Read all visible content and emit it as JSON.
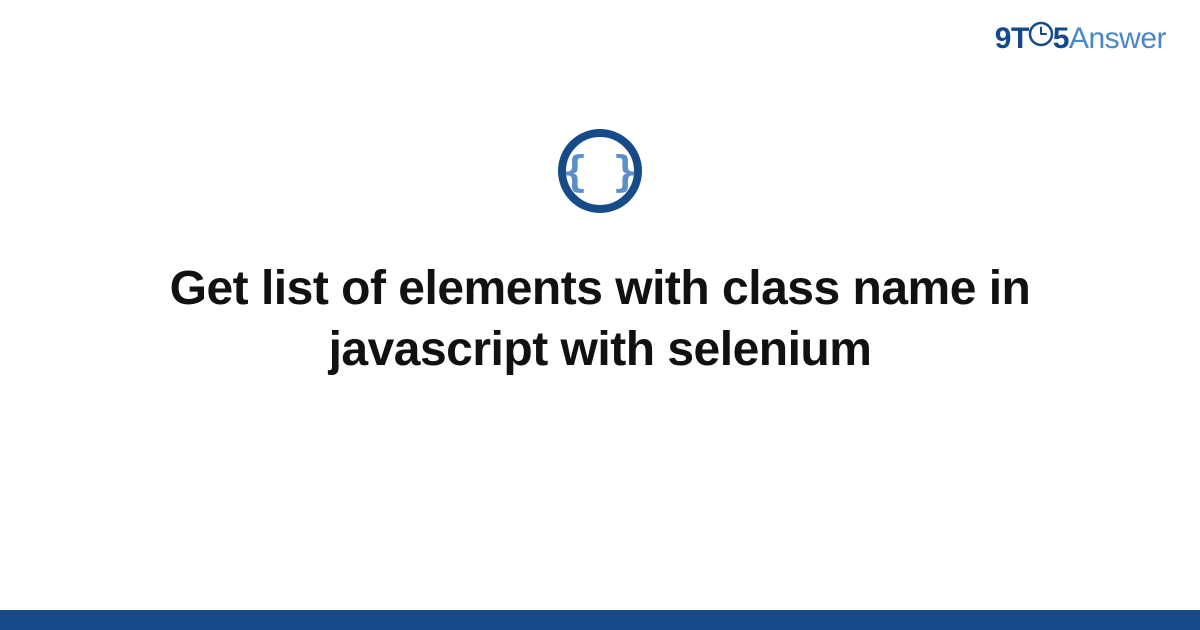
{
  "brand": {
    "nine": "9",
    "t": "T",
    "five": "5",
    "answer": "Answer"
  },
  "title": "Get list of elements with class name in javascript with selenium",
  "colors": {
    "brand_dark": "#154a8a",
    "brand_light": "#4a87c9",
    "bottom_bar": "#164a89",
    "icon_inner": "#5a8fc9",
    "icon_ring": "#164a89"
  }
}
